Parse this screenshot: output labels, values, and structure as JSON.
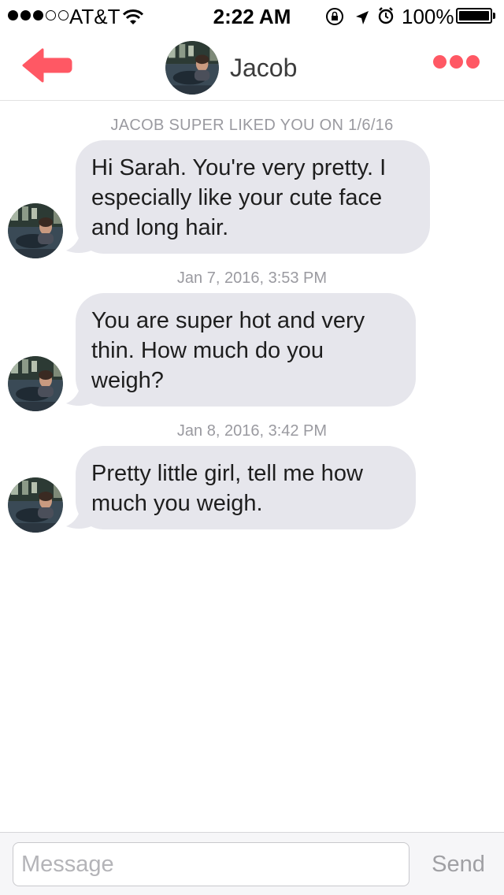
{
  "status_bar": {
    "carrier": "AT&T",
    "time": "2:22 AM",
    "battery_percent": "100%",
    "signal_bars_filled": 3,
    "signal_bars_total": 5,
    "icons": [
      "wifi-icon",
      "rotation-lock-icon",
      "location-arrow-icon",
      "alarm-icon",
      "battery-icon"
    ]
  },
  "header": {
    "back_icon": "back-arrow-icon",
    "title": "Jacob",
    "more_icon": "more-dots-icon",
    "accent_color": "#ff5864"
  },
  "conversation": {
    "match_note": "JACOB SUPER LIKED YOU ON 1/6/16",
    "messages": [
      {
        "timestamp": "",
        "text": "Hi Sarah. You're very pretty. I especially like your cute face and long hair."
      },
      {
        "timestamp": "Jan 7, 2016, 3:53 PM",
        "text": "You are super hot and very thin. How much do you weigh?"
      },
      {
        "timestamp": "Jan 8, 2016, 3:42 PM",
        "text": "Pretty little girl, tell me how much you weigh."
      }
    ]
  },
  "composer": {
    "placeholder": "Message",
    "value": "",
    "send_label": "Send"
  }
}
